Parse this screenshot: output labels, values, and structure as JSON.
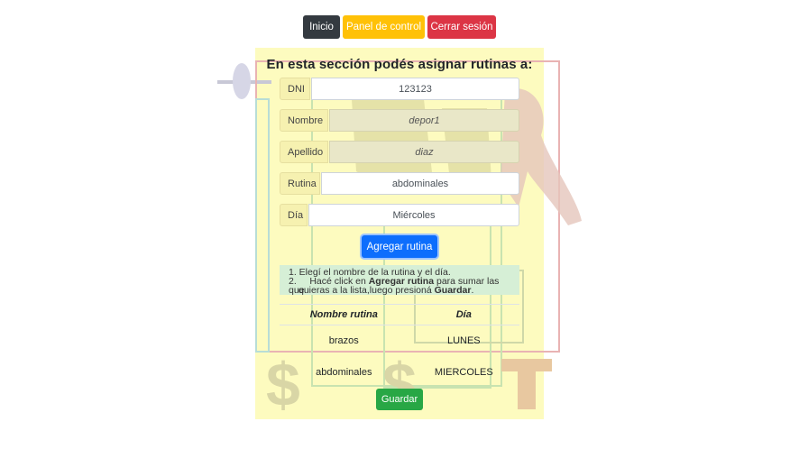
{
  "nav": {
    "inicio": "Inicio",
    "panel": "Panel de control",
    "cerrar": "Cerrar sesión"
  },
  "title": "En esta sección podés asignar rutinas a:",
  "form": {
    "dni_label": "DNI",
    "dni_value": "123123",
    "nombre_label": "Nombre",
    "nombre_value": "depor1",
    "apellido_label": "Apellido",
    "apellido_value": "diaz",
    "rutina_label": "Rutina",
    "rutina_value": "abdominales",
    "dia_label": "Día",
    "dia_value": "Miércoles"
  },
  "agregar_button": "Agregar rutina",
  "instructions": {
    "line1": "1. Elegí el nombre de la rutina y el día.",
    "line2_prefix": "2.     Hacé click en ",
    "line2_bold": "Agregar rutina",
    "line2_suffix": " para sumar las que",
    "line3_prefix": "quieras a la lista,luego presioná ",
    "line3_bold": "Guardar",
    "line3_suffix": "."
  },
  "table": {
    "headers": [
      "Nombre rutina",
      "Día"
    ],
    "rows": [
      [
        "brazos",
        "LUNES"
      ],
      [
        "abdominales",
        "MIERCOLES"
      ]
    ]
  },
  "guardar_button": "Guardar",
  "colors": {
    "panel_bg": "#fdfbbf",
    "primary": "#0d6efd",
    "success": "#28a745",
    "warning": "#ffc107",
    "danger": "#dc3545",
    "dark": "#343a40"
  }
}
